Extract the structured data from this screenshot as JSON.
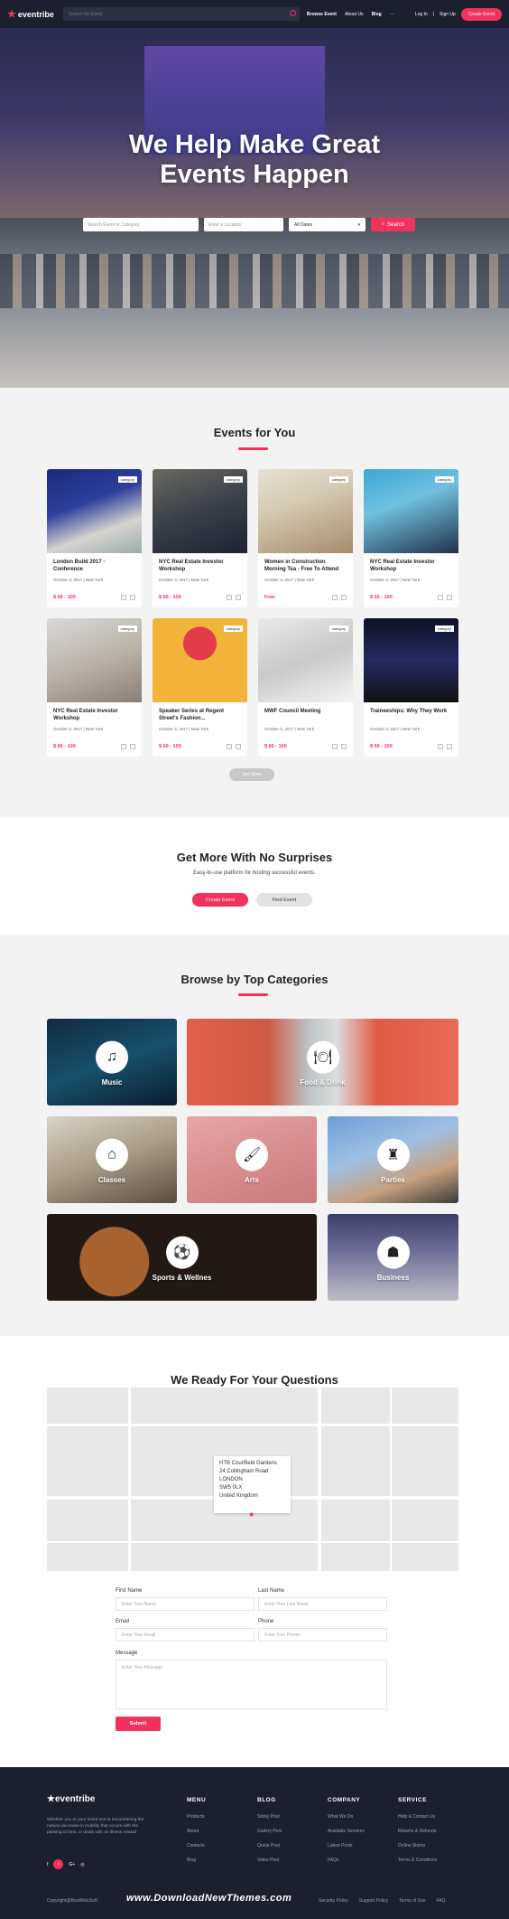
{
  "nav": {
    "logo": "eventribe",
    "search_placeholder": "Search for Event",
    "links": [
      "Browse Event",
      "About Us",
      "Blog",
      "···"
    ],
    "login": "Log In",
    "separator": "|",
    "signup": "Sign Up",
    "create_event": "Create Event"
  },
  "hero": {
    "title_line1": "We Help Make Great",
    "title_line2": "Events Happen",
    "search_event_placeholder": "Search Event or Category",
    "location_placeholder": "Enter a Location",
    "date_selected": "All Dates",
    "search_button": "Search"
  },
  "events": {
    "title": "Events for You",
    "items": [
      {
        "tag": "category",
        "title": "London Build 2017 - Conference",
        "meta": "October 3, 2017  |  New York",
        "price": "$ 60 - 100"
      },
      {
        "tag": "category",
        "title": "NYC Real Estate Investor Workshop",
        "meta": "October 3, 2017  |  New York",
        "price": "$ 60 - 100"
      },
      {
        "tag": "category",
        "title": "Women in Construction Morning Tea - Free To Attend",
        "meta": "October 3, 2017  |  New York",
        "price": "Free"
      },
      {
        "tag": "category",
        "title": "NYC Real Estate Investor Workshop",
        "meta": "October 3, 2017  |  New York",
        "price": "$ 60 - 100"
      },
      {
        "tag": "category",
        "title": "NYC Real Estate Investor Workshop",
        "meta": "October 3, 2017  |  New York",
        "price": "$ 60 - 100"
      },
      {
        "tag": "category",
        "title": "Speaker Series at Regent Street's Fashion...",
        "meta": "October 3, 2017  |  New York",
        "price": "$ 60 - 100"
      },
      {
        "tag": "category",
        "title": "MWF Council Meeting",
        "meta": "October 3, 2017  |  New York",
        "price": "$ 60 - 100"
      },
      {
        "tag": "category",
        "title": "Traineeships: Why They Work",
        "meta": "October 3, 2017  |  New York",
        "price": "$ 60 - 100"
      }
    ],
    "see_more": "See More"
  },
  "promo": {
    "title": "Get More With No Surprises",
    "subtitle": "Easy-to-use platform for hosting successful events.",
    "create_button": "Create Event",
    "find_button": "Find Event"
  },
  "categories": {
    "title": "Browse by Top Categories",
    "items": [
      {
        "label": "Music",
        "icon": "music-note-icon"
      },
      {
        "label": "Food & Drink",
        "icon": "food-drink-icon"
      },
      {
        "label": "Classes",
        "icon": "classes-icon"
      },
      {
        "label": "Arts",
        "icon": "paint-roller-icon"
      },
      {
        "label": "Parties",
        "icon": "parties-icon"
      },
      {
        "label": "Sports & Wellnes",
        "icon": "sports-ball-icon"
      },
      {
        "label": "Business",
        "icon": "business-icon"
      }
    ]
  },
  "contact": {
    "title": "We Ready For Your Questions",
    "address": [
      "HTB Courtfield Gardens",
      "24 Collingham Road",
      "LONDON",
      "SW5 0LX",
      "United Kingdom"
    ],
    "first_name_label": "First Name",
    "first_name_placeholder": "Enter Your Name",
    "last_name_label": "Last Name",
    "last_name_placeholder": "Enter Your Last Name",
    "email_label": "Email",
    "email_placeholder": "Enter Your Email",
    "phone_label": "Phone",
    "phone_placeholder": "Enter Your Phone",
    "message_label": "Message",
    "message_placeholder": "Enter Your Message",
    "submit": "Submit"
  },
  "footer": {
    "logo": "eventribe",
    "about": "Whether you or your loved one is encountering the natural decrease in mobility that occurs with the passing of time, or deals with an illness related",
    "columns": [
      {
        "title": "MENU",
        "links": [
          "Products",
          "About",
          "Contacts",
          "Blog"
        ]
      },
      {
        "title": "BLOG",
        "links": [
          "Sticky Post",
          "Gallery Post",
          "Quote Post",
          "Video Post"
        ]
      },
      {
        "title": "COMPANY",
        "links": [
          "What We Do",
          "Available Services",
          "Latest Posts",
          "FAQs"
        ]
      },
      {
        "title": "SERVICE",
        "links": [
          "Help & Contact Us",
          "Returns & Refunds",
          "Online Stores",
          "Terms & Conditions"
        ]
      }
    ],
    "social": [
      "f",
      "t",
      "G+",
      "◎"
    ],
    "copyright": "Copyright@BootWebSoft",
    "watermark": "www.DownloadNewThemes.com",
    "bottom_links": [
      "Security Policy",
      "Support Policy",
      "Terms of Use",
      "FAQ"
    ]
  }
}
